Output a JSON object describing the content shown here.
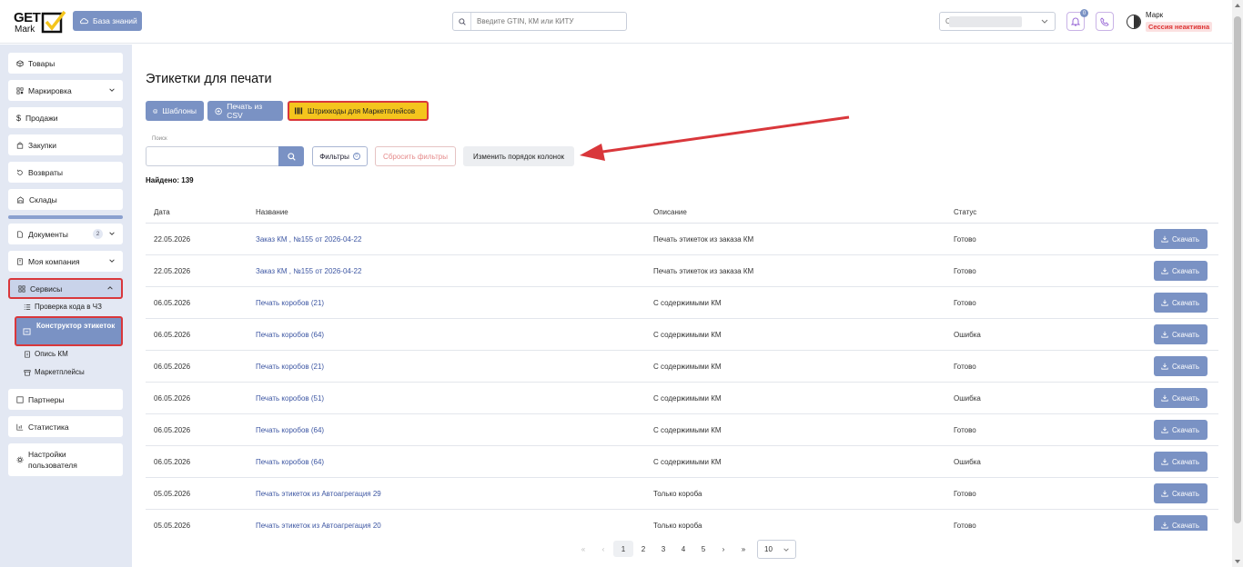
{
  "header": {
    "logo_top": "GET",
    "logo_bottom": "Mark",
    "kb_label": "База знаний",
    "search_placeholder": "Введите GTIN, КМ или КИТУ",
    "org_prefix": "С",
    "notif_count": "0",
    "user_name": "Марк",
    "session_status": "Сессия неактивна"
  },
  "sidebar": {
    "goods": "Товары",
    "marking": "Маркировка",
    "sales": "Продажи",
    "purchases": "Закупки",
    "returns": "Возвраты",
    "warehouses": "Склады",
    "documents": "Документы",
    "documents_count": "2",
    "company": "Моя компания",
    "services": "Сервисы",
    "sub_check": "Проверка кода в ЧЗ",
    "sub_constructor": "Конструктор этикеток",
    "sub_inventory": "Опись КМ",
    "sub_marketplaces": "Маркетплейсы",
    "partners": "Партнеры",
    "stats": "Статистика",
    "settings": "Настройки пользователя"
  },
  "main": {
    "title": "Этикетки для печати",
    "btn_templates": "Шаблоны",
    "btn_csv": "Печать из CSV",
    "btn_barcodes": "Штрихкоды для Маркетплейсов",
    "search_label": "Поиск",
    "filters": "Фильтры",
    "filters_count": "0",
    "reset": "Сбросить фильтры",
    "order": "Изменить порядок колонок",
    "found": "Найдено: 139"
  },
  "table": {
    "headers": {
      "date": "Дата",
      "name": "Название",
      "desc": "Описание",
      "status": "Статус"
    },
    "download_label": "Скачать",
    "rows": [
      {
        "date": "22.05.2026",
        "name": "Заказ КМ , №155 от 2026-04-22",
        "desc": "Печать этикеток из заказа КМ",
        "status": "Готово"
      },
      {
        "date": "22.05.2026",
        "name": "Заказ КМ , №155 от 2026-04-22",
        "desc": "Печать этикеток из заказа КМ",
        "status": "Готово"
      },
      {
        "date": "06.05.2026",
        "name": "Печать коробов (21)",
        "desc": "С содержимыми КМ",
        "status": "Готово"
      },
      {
        "date": "06.05.2026",
        "name": "Печать коробов (64)",
        "desc": "С содержимыми КМ",
        "status": "Ошибка"
      },
      {
        "date": "06.05.2026",
        "name": "Печать коробов (21)",
        "desc": "С содержимыми КМ",
        "status": "Готово"
      },
      {
        "date": "06.05.2026",
        "name": "Печать коробов (51)",
        "desc": "С содержимыми КМ",
        "status": "Ошибка"
      },
      {
        "date": "06.05.2026",
        "name": "Печать коробов (64)",
        "desc": "С содержимыми КМ",
        "status": "Готово"
      },
      {
        "date": "06.05.2026",
        "name": "Печать коробов (64)",
        "desc": "С содержимыми КМ",
        "status": "Ошибка"
      },
      {
        "date": "05.05.2026",
        "name": "Печать этикеток из Автоагрегация 29",
        "desc": "Только короба",
        "status": "Готово"
      },
      {
        "date": "05.05.2026",
        "name": "Печать этикеток из Автоагрегация 20",
        "desc": "Только короба",
        "status": "Готово"
      }
    ]
  },
  "pager": {
    "first": "«",
    "prev": "‹",
    "pages": [
      "1",
      "2",
      "3",
      "4",
      "5"
    ],
    "next": "›",
    "last": "»",
    "page_size": "10"
  },
  "colors": {
    "accent": "#7a92c4",
    "highlight": "#f4c51d",
    "annotation": "#d9373b"
  }
}
